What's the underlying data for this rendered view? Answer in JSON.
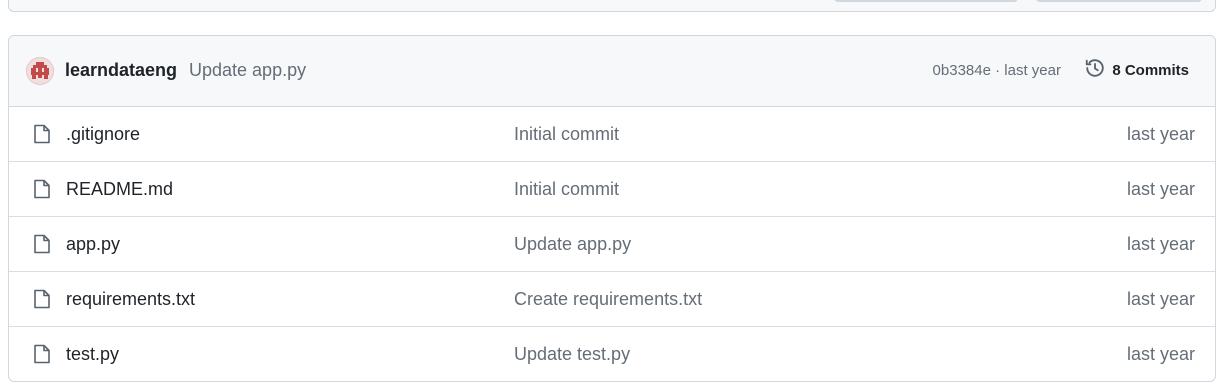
{
  "latest_commit": {
    "author": "learndataeng",
    "message": "Update app.py",
    "hash": "0b3384e",
    "separator": "·",
    "age": "last year",
    "history_label": "8 Commits",
    "avatar_color": "#c24a4a"
  },
  "files": [
    {
      "name": ".gitignore",
      "message": "Initial commit",
      "age": "last year",
      "icon": "file-icon"
    },
    {
      "name": "README.md",
      "message": "Initial commit",
      "age": "last year",
      "icon": "file-icon"
    },
    {
      "name": "app.py",
      "message": "Update app.py",
      "age": "last year",
      "icon": "file-icon"
    },
    {
      "name": "requirements.txt",
      "message": "Create requirements.txt",
      "age": "last year",
      "icon": "file-icon"
    },
    {
      "name": "test.py",
      "message": "Update test.py",
      "age": "last year",
      "icon": "file-icon"
    }
  ]
}
